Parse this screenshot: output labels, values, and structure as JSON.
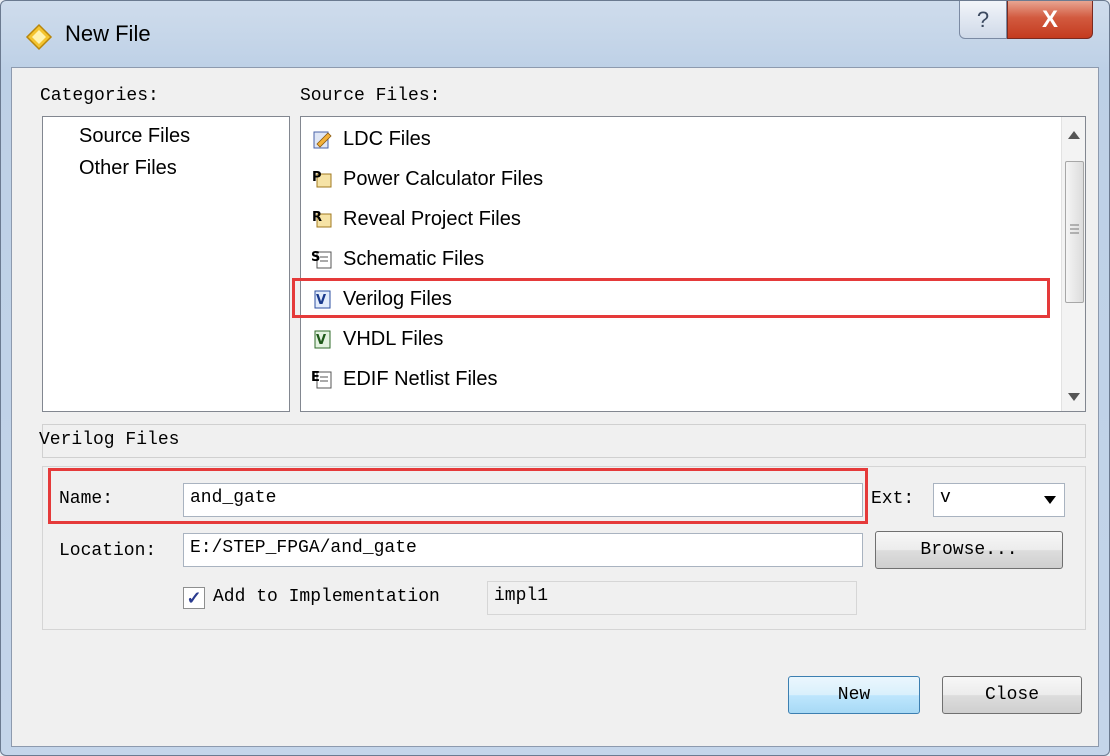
{
  "window": {
    "title": "New File",
    "help_glyph": "?",
    "close_glyph": "X"
  },
  "categories": {
    "label": "Categories:",
    "items": [
      "Source Files",
      "Other Files"
    ]
  },
  "source_files": {
    "label": "Source Files:",
    "items": [
      {
        "label": "LDC Files",
        "icon": "ldc-file-icon"
      },
      {
        "label": "Power Calculator Files",
        "icon": "power-calculator-file-icon"
      },
      {
        "label": "Reveal Project Files",
        "icon": "reveal-project-file-icon"
      },
      {
        "label": "Schematic Files",
        "icon": "schematic-file-icon"
      },
      {
        "label": "Verilog Files",
        "icon": "verilog-file-icon"
      },
      {
        "label": "VHDL Files",
        "icon": "vhdl-file-icon"
      },
      {
        "label": "EDIF Netlist Files",
        "icon": "edif-netlist-file-icon"
      }
    ],
    "selected": "Verilog Files"
  },
  "description": "Verilog Files",
  "form": {
    "name_label": "Name:",
    "name_value": "and_gate",
    "ext_label": "Ext:",
    "ext_value": "v",
    "location_label": "Location:",
    "location_value": "E:/STEP_FPGA/and_gate",
    "browse_label": "Browse...",
    "add_impl_label": "Add to Implementation",
    "add_impl_checked": true,
    "impl_value": "impl1"
  },
  "buttons": {
    "new_label": "New",
    "close_label": "Close"
  },
  "colors": {
    "highlight_red": "#e53a3a"
  }
}
